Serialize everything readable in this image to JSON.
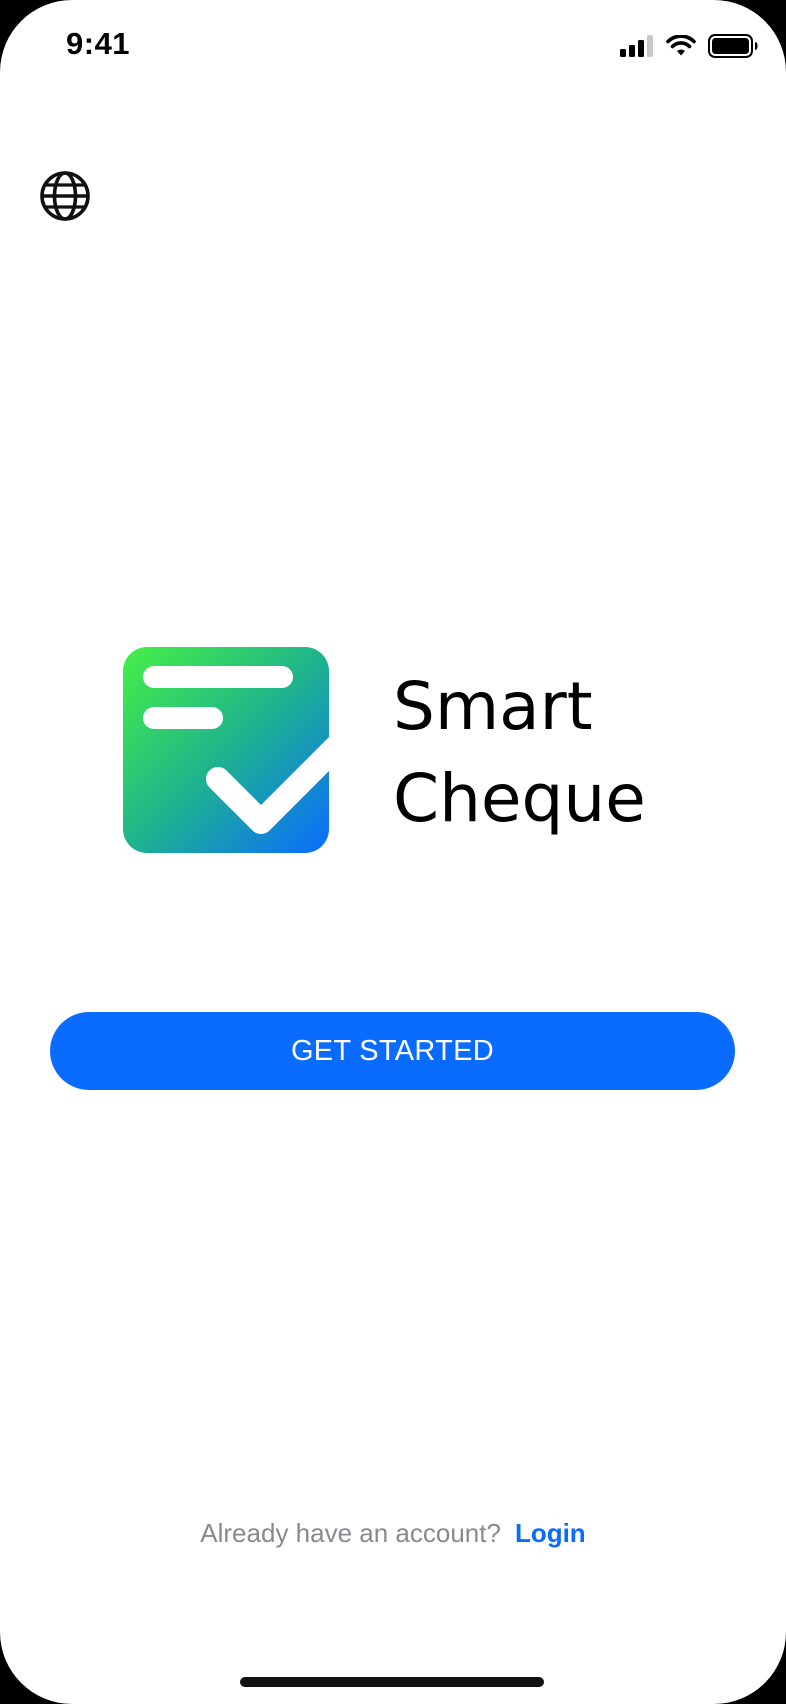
{
  "status_bar": {
    "time": "9:41",
    "icons": [
      "cellular-signal-icon",
      "wifi-icon",
      "battery-icon"
    ]
  },
  "header": {
    "language_icon": "globe-icon"
  },
  "brand": {
    "logo_icon": "checklist-check-icon",
    "name_line1": "Smart",
    "name_line2": "Cheque",
    "gradient_start": "#46f046",
    "gradient_end": "#0a6cff"
  },
  "actions": {
    "get_started_label": "GET STARTED",
    "login_prompt": "Already have an account?",
    "login_label": "Login"
  },
  "colors": {
    "accent": "#0a6cff",
    "muted_text": "#8a8a8e",
    "background": "#ffffff"
  }
}
